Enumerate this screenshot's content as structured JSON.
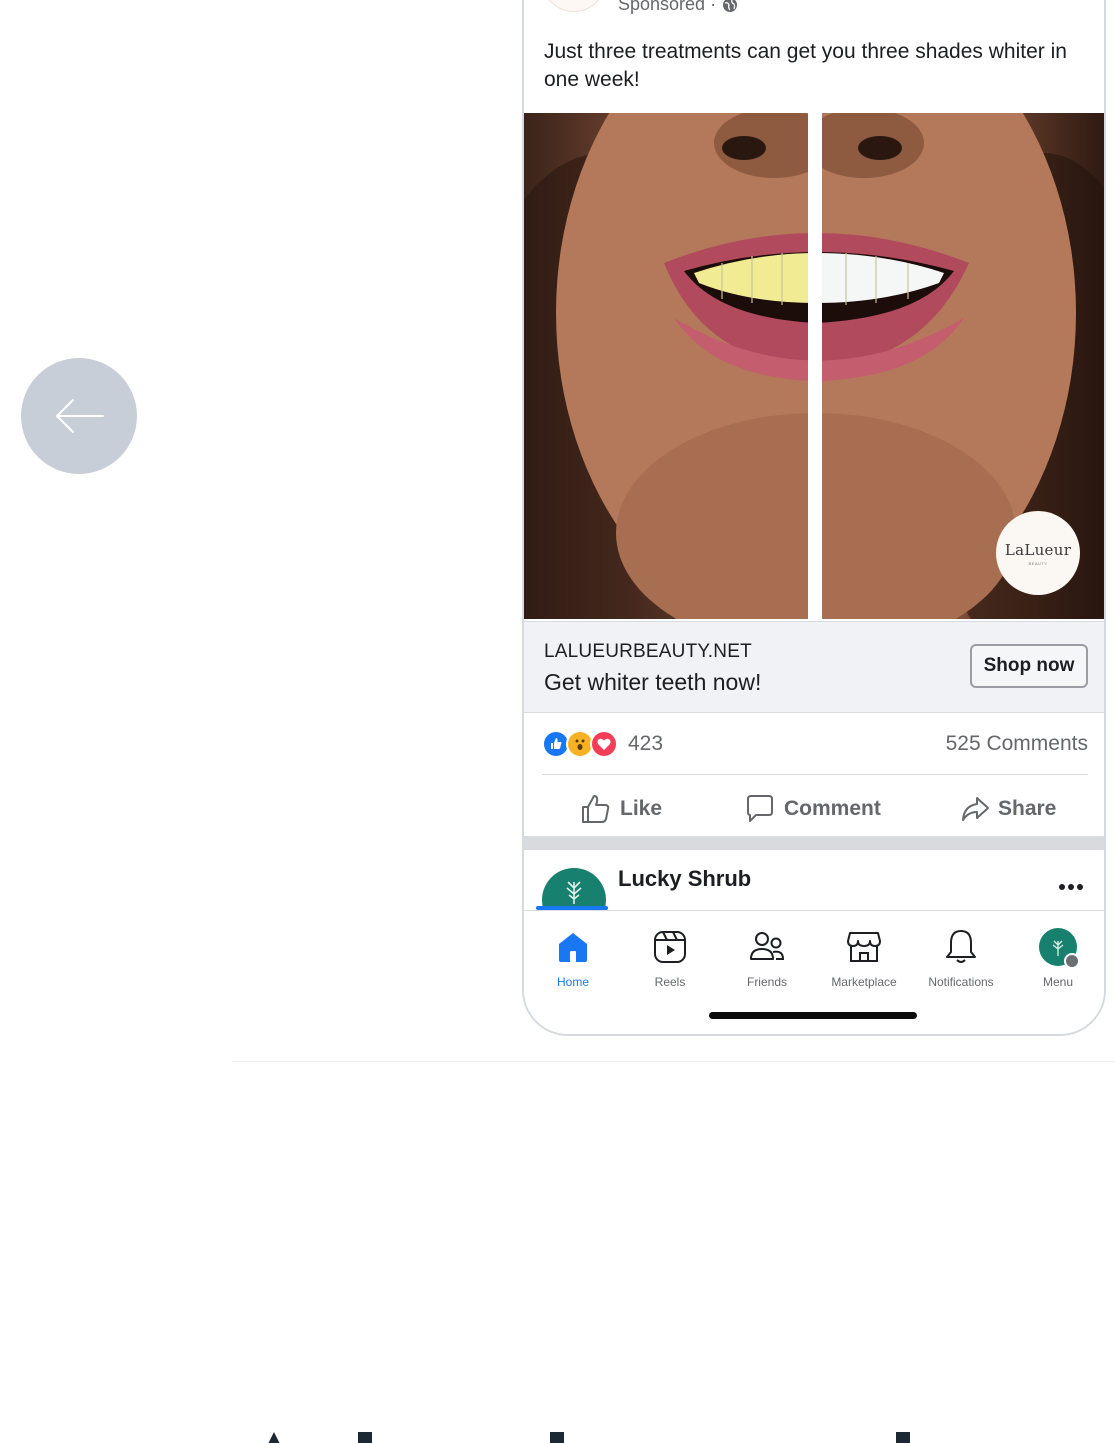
{
  "post": {
    "sponsored_label": "Sponsored ·",
    "text": "Just three treatments can get you three shades whiter in one week!",
    "brand_badge": "LaLueur",
    "brand_badge_sub": "BEAUTY"
  },
  "cta": {
    "domain": "LALUEURBEAUTY.NET",
    "headline": "Get whiter teeth now!",
    "button_label": "Shop now"
  },
  "engagement": {
    "reaction_count": "423",
    "comments_count": "525 Comments",
    "reactions": [
      "like-icon",
      "wow-icon",
      "love-icon"
    ]
  },
  "actions": {
    "like": "Like",
    "comment": "Comment",
    "share": "Share"
  },
  "next_post": {
    "page_name": "Lucky Shrub"
  },
  "tabbar": {
    "items": [
      {
        "label": "Home",
        "icon": "home-icon",
        "active": true
      },
      {
        "label": "Reels",
        "icon": "reels-icon",
        "active": false
      },
      {
        "label": "Friends",
        "icon": "friends-icon",
        "active": false
      },
      {
        "label": "Marketplace",
        "icon": "marketplace-icon",
        "active": false
      },
      {
        "label": "Notifications",
        "icon": "bell-icon",
        "active": false
      },
      {
        "label": "Menu",
        "icon": "menu-avatar",
        "active": false
      }
    ]
  },
  "colors": {
    "accent": "#1877f2",
    "back_button": "#c8ced8",
    "cta_bar": "#f0f2f5",
    "lucky_shrub_green": "#17806e"
  }
}
